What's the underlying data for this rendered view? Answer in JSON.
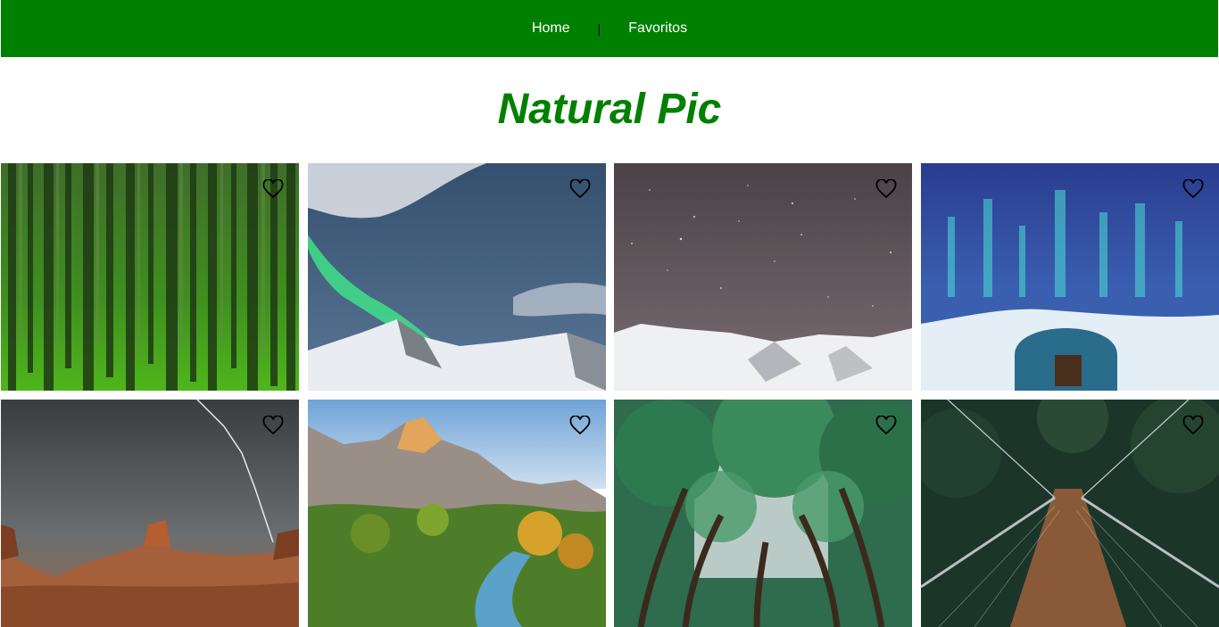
{
  "nav": {
    "items": [
      {
        "label": "Home"
      },
      {
        "label": "Favoritos"
      }
    ],
    "separator": "|"
  },
  "header": {
    "title": "Natural Pic"
  },
  "gallery": {
    "photos": [
      {
        "name": "forest-photo",
        "favorite": false
      },
      {
        "name": "aurora-mountain-photo",
        "favorite": false
      },
      {
        "name": "starry-snow-mountains-photo",
        "favorite": false
      },
      {
        "name": "aurora-igloo-photo",
        "favorite": false
      },
      {
        "name": "desert-lightning-photo",
        "favorite": false
      },
      {
        "name": "canyon-river-photo",
        "favorite": false
      },
      {
        "name": "tree-tunnel-photo",
        "favorite": false
      },
      {
        "name": "suspension-bridge-photo",
        "favorite": false
      }
    ]
  },
  "colors": {
    "brand": "#008000",
    "nav_text": "#ffffff"
  }
}
